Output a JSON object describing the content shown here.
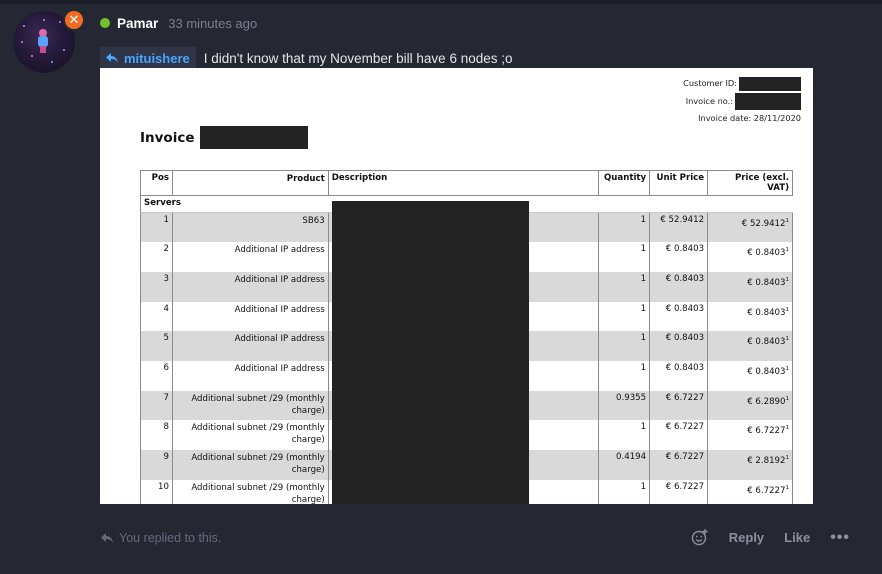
{
  "post": {
    "author": "Pamar",
    "timestamp": "33 minutes ago",
    "mention": "mituishere",
    "text": "I didn't know that my November bill have 6 nodes ;o"
  },
  "invoice": {
    "customer_id_label": "Customer ID:",
    "invoice_no_label": "Invoice no.:",
    "invoice_date": "Invoice date: 28/11/2020",
    "title": "Invoice",
    "columns": {
      "pos": "Pos",
      "product": "Product",
      "description": "Description",
      "quantity": "Quantity",
      "unit_price": "Unit Price",
      "price": "Price (excl. VAT)"
    },
    "section": "Servers",
    "rows": [
      {
        "pos": "1",
        "product": "SB63",
        "qty": "1",
        "unit": "€ 52.9412",
        "price": "€ 52.9412"
      },
      {
        "pos": "2",
        "product": "Additional IP address",
        "qty": "1",
        "unit": "€ 0.8403",
        "price": "€ 0.8403"
      },
      {
        "pos": "3",
        "product": "Additional IP address",
        "qty": "1",
        "unit": "€ 0.8403",
        "price": "€ 0.8403"
      },
      {
        "pos": "4",
        "product": "Additional IP address",
        "qty": "1",
        "unit": "€ 0.8403",
        "price": "€ 0.8403"
      },
      {
        "pos": "5",
        "product": "Additional IP address",
        "qty": "1",
        "unit": "€ 0.8403",
        "price": "€ 0.8403"
      },
      {
        "pos": "6",
        "product": "Additional IP address",
        "qty": "1",
        "unit": "€ 0.8403",
        "price": "€ 0.8403"
      },
      {
        "pos": "7",
        "product": "Additional subnet /29 (monthly charge)",
        "qty": "0.9355",
        "unit": "€ 6.7227",
        "price": "€ 6.2890"
      },
      {
        "pos": "8",
        "product": "Additional subnet /29 (monthly charge)",
        "qty": "1",
        "unit": "€ 6.7227",
        "price": "€ 6.7227"
      },
      {
        "pos": "9",
        "product": "Additional subnet /29 (monthly charge)",
        "qty": "0.4194",
        "unit": "€ 6.7227",
        "price": "€ 2.8192"
      },
      {
        "pos": "10",
        "product": "Additional subnet /29 (monthly charge)",
        "qty": "1",
        "unit": "€ 6.7227",
        "price": "€ 6.7227"
      }
    ],
    "footnote_mark": "1"
  },
  "footer": {
    "replied_text": "You replied to this.",
    "reply_label": "Reply",
    "like_label": "Like",
    "more_label": "•••"
  },
  "colors": {
    "background": "#252733",
    "online": "#72c02c",
    "badge": "#f26b22",
    "mention": "#4aa5ff"
  }
}
